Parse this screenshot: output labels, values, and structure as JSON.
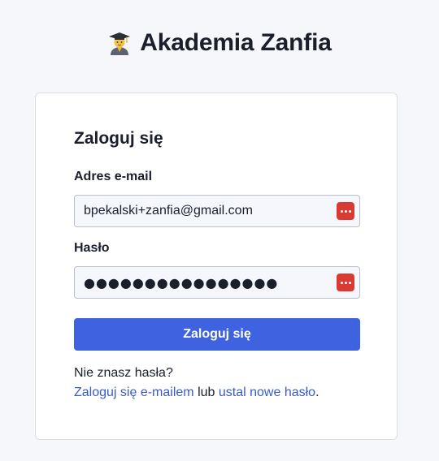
{
  "brand": {
    "title": "Akademia Zanfia",
    "icon": "student-graduation-cap-icon"
  },
  "login_card": {
    "title": "Zaloguj się",
    "email": {
      "label": "Adres e-mail",
      "value": "bpekalski+zanfia@gmail.com",
      "password_manager_icon": "password-manager-icon"
    },
    "password": {
      "label": "Hasło",
      "value": "●●●●●●●●●●●●●●●●",
      "password_manager_icon": "password-manager-icon"
    },
    "submit_label": "Zaloguj się",
    "forgot": {
      "question": "Nie znasz hasła?",
      "email_login_link": "Zaloguj się e-mailem",
      "connector": "lub",
      "reset_link": "ustal nowe hasło",
      "end": "."
    }
  },
  "colors": {
    "background": "#f5f7fb",
    "primary_button": "#3f63e0",
    "link": "#3a5bc7",
    "password_manager": "#d93a32"
  }
}
